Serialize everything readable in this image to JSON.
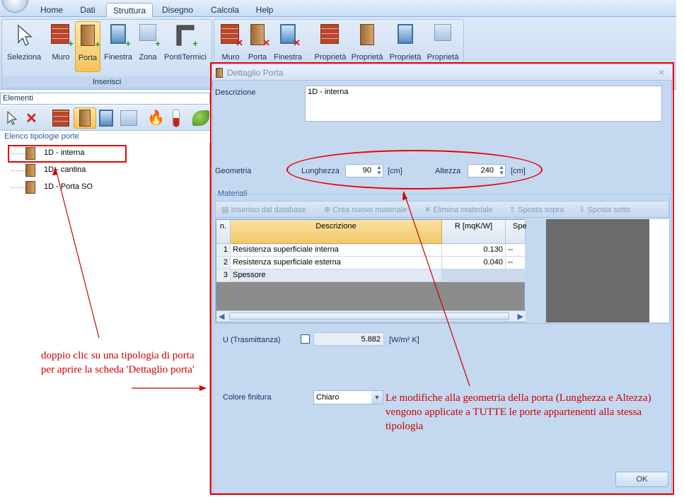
{
  "ribbon": {
    "tabs": [
      "Home",
      "Dati",
      "Struttura",
      "Disegno",
      "Calcola",
      "Help"
    ],
    "active_tab": "Struttura",
    "group_inserisci_label": "Inserisci",
    "buttons": {
      "seleziona": "Seleziona",
      "muro": "Muro",
      "porta": "Porta",
      "finestra": "Finestra",
      "zona": "Zona",
      "pontitermici": "PontiTermici",
      "del_muro": "Muro",
      "del_porta": "Porta",
      "del_finestra": "Finestra",
      "prop1": "Proprietà",
      "prop2": "Proprietà",
      "prop3": "Proprietà",
      "prop4": "Proprietà"
    }
  },
  "left": {
    "elements_dropdown": "Elementi",
    "list_header": "Elenco tipologie porte",
    "items": [
      "1D - interna",
      "1D - cantina",
      "1D - Porta SO"
    ]
  },
  "dialog": {
    "title": "Dettaglio Porta",
    "descrizione_label": "Descrizione",
    "descrizione_value": "1D - interna",
    "geometria_label": "Geometria",
    "lunghezza_label": "Lunghezza",
    "lunghezza_value": "90",
    "altezza_label": "Altezza",
    "altezza_value": "240",
    "unit_cm": "[cm]",
    "materiali_label": "Materiali",
    "toolbar": {
      "inserisci": "Inserisci dal database",
      "crea": "Crea nuovo materiale",
      "elimina": "Elimina materiale",
      "sopra": "Sposta sopra",
      "sotto": "Sposta sotto"
    },
    "grid": {
      "headers": [
        "n.",
        "Descrizione",
        "R [mqK/W]",
        "Spe"
      ],
      "rows": [
        {
          "n": "1",
          "desc": "Resistenza superficiale interna",
          "r": "0.130",
          "spe": "--"
        },
        {
          "n": "2",
          "desc": "Resistenza superficiale esterna",
          "r": "0.040",
          "spe": "--"
        },
        {
          "n": "3",
          "desc": "Spessore",
          "r": "",
          "spe": ""
        }
      ]
    },
    "u_label": "U (Trasmittanza)",
    "u_value": "5.882",
    "u_unit": "[W/m² K]",
    "colore_label": "Colore finitura",
    "colore_value": "Chiaro",
    "ok_label": "OK"
  },
  "annotations": {
    "left": "doppio clic su una tipologia di porta per aprire la scheda 'Dettaglio porta'",
    "right": "Le modifiche alla geometria della porta (Lunghezza e Altezza) vengono applicate a TUTTE le porte appartenenti alla stessa tipologia"
  },
  "colors": {
    "annotation": "#cc0000",
    "ribbon": "#c5d8f0",
    "selected": "#f6c35a"
  }
}
